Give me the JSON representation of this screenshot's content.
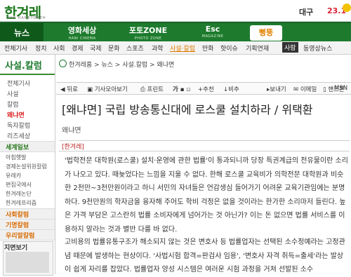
{
  "header": {
    "logo": "한겨레",
    "logo_sub": "THE HANKYOREH",
    "weather_city": "대구",
    "weather_temp": "23.1"
  },
  "nav": {
    "news": "뉴스",
    "sections": [
      {
        "title": "영화세상",
        "sub": "HANI CINEMA"
      },
      {
        "title": "포토ZONE",
        "sub": "PHOTO ZONE"
      },
      {
        "title": "Esc",
        "sub": "MAGAZINE"
      }
    ],
    "ppeong": "뻥뚱"
  },
  "subnav": {
    "items": [
      "전체기사",
      "정치",
      "사회",
      "경제",
      "국제",
      "문화",
      "스포츠",
      "과학",
      "사설·칼럼",
      "만화",
      "핫이슈",
      "기획연재",
      "사람",
      "동영상뉴스"
    ]
  },
  "left": {
    "title": "사설.칼럼",
    "menu": [
      "전체기사",
      "사설",
      "칼럼",
      "왜냐면",
      "독자칼럼",
      "리즈세상"
    ],
    "active_index": 3,
    "section1": "세계일보",
    "section1_items": [
      "아침햇발",
      "경제논설위원칼럼",
      "유레카",
      "편집국에서",
      "한겨레논단",
      "한겨레프리즘"
    ],
    "section2": "사회칼럼",
    "section3": "기명칼럼",
    "section4": "우리말칼럼",
    "box_label": "지면보기"
  },
  "breadcrumb": "한겨레홈 > 뉴스 > 사설.칼럼 > 왜냐면",
  "toolbar": {
    "prev": "뒤로",
    "copy_url": "기사모아보기",
    "print": "프린트",
    "font_plus": "가",
    "enlarge": "+추천",
    "agree": "비추",
    "send": "보내기",
    "email": "이메일",
    "mobile": "핸드폰",
    "msn": "MSN"
  },
  "article": {
    "headline": "[왜냐면] 국립 방송통신대에 로스쿨 설치하라 / 위택환",
    "section_name": "왜냐면",
    "byline": "[한겨레]",
    "p1": "'법학전문 대학원(로스쿨) 설치·운영에 관한 법률'이 통과되니까 당장 특권계급의 전유물이란 소리가 나오고 있다. 때늦었다는 느낌을 지울 수 없다. 한해 로스쿨 교육비가 의학전문 대학원과 비슷한 2천만~3천만원이라고 하니 서민의 자녀들은 언감생심 들어가기 어려운 교육기관임에는 분명하다. 9천만원의 학자금을 융자해 주어도 학비 걱정은 없을 것이라는 한가한 소리마저 들린다. 높은 가격 부담은 고스란히 법률 소비자에게 넘어가는 것 아닌가? 이는 돈 없으면 법률 서비스를 이용하지 말라는 것과 별반 다를 바 없다.",
    "p2": "고비용의 법률유통구조가 해소되지 않는 것은 변호사 등 법률업자는 선택된 소수정예라는 고정관념 때문에 발생하는 현상이다. '사법시험 합격=판검사 임용', '변호사 자격 취득=출세'라는 발상이 쉽게 자리를 잡았다. 법률업자 양성 시스템은 여러운 시험 과정을 거쳐 선발된 소수"
  },
  "colors": {
    "brand_green": "#1e7b2e",
    "active_orange": "#e07a00",
    "accent_red": "#d22"
  }
}
